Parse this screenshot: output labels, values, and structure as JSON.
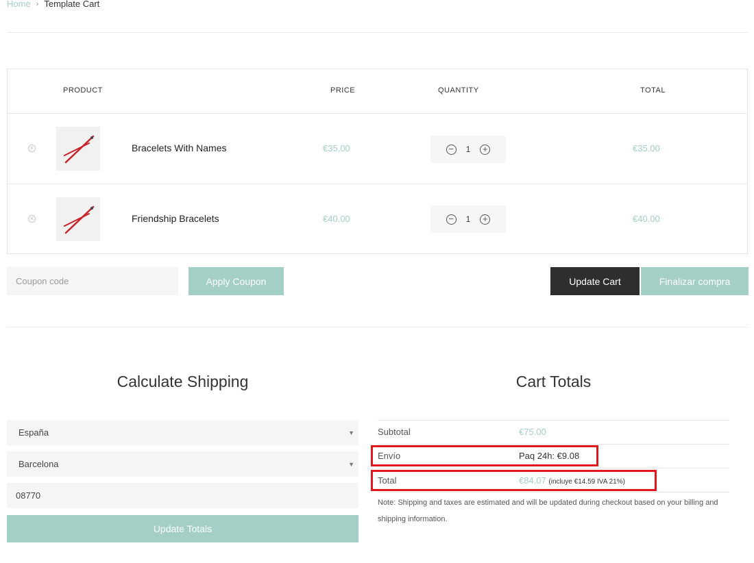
{
  "breadcrumb": {
    "home": "Home",
    "separator": "›",
    "current": "Template Cart"
  },
  "table": {
    "headers": {
      "product": "PRODUCT",
      "price": "PRICE",
      "quantity": "QUANTITY",
      "total": "TOTAL"
    },
    "rows": [
      {
        "name": "Bracelets With Names",
        "price": "€35.00",
        "qty": "1",
        "total": "€35.00"
      },
      {
        "name": "Friendship Bracelets",
        "price": "€40.00",
        "qty": "1",
        "total": "€40.00"
      }
    ],
    "remove_glyph": "×",
    "minus_glyph": "−",
    "plus_glyph": "+"
  },
  "actions": {
    "coupon_placeholder": "Coupon code",
    "apply_coupon": "Apply Coupon",
    "update_cart": "Update Cart",
    "checkout": "Finalizar compra"
  },
  "shipping": {
    "title": "Calculate Shipping",
    "country": "España",
    "city": "Barcelona",
    "postcode": "08770",
    "update_totals": "Update Totals",
    "caret": "▼"
  },
  "totals": {
    "title": "Cart Totals",
    "subtotal_label": "Subtotal",
    "subtotal_value": "€75.00",
    "shipping_label": "Envío",
    "shipping_value": "Paq 24h: €9.08",
    "total_label": "Total",
    "total_value": "€84.07",
    "tax_note": "(incluye €14.59 IVA 21%)",
    "note": "Note: Shipping and taxes are estimated and will be updated during checkout based on your billing and shipping information."
  },
  "colors": {
    "accent": "#a3cfc6",
    "dark": "#2e2e2e",
    "highlight": "#e2161d"
  }
}
